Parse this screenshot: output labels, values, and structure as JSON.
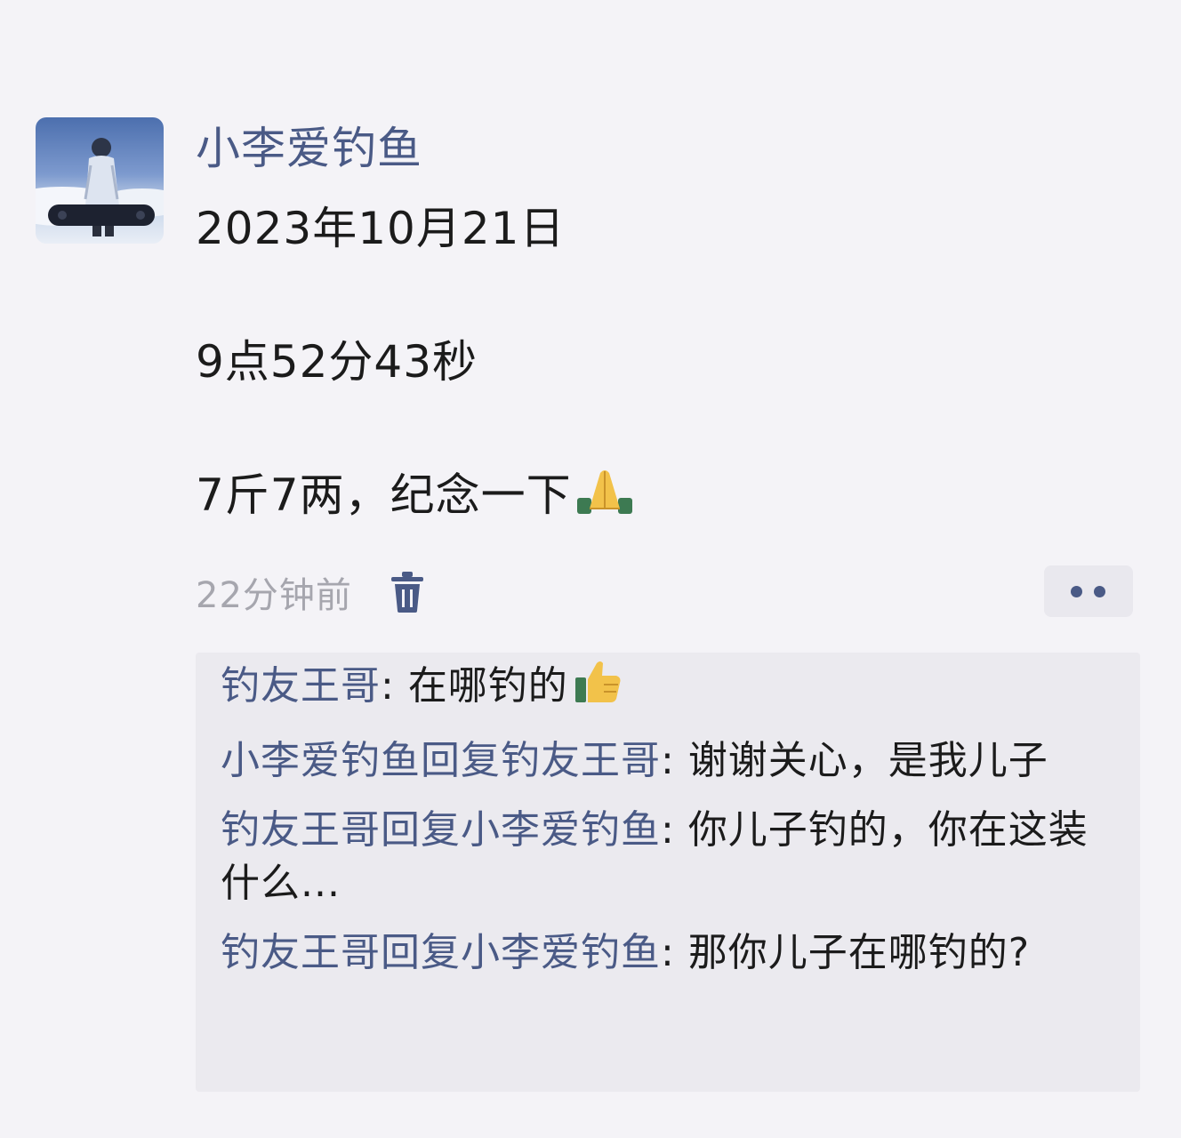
{
  "post": {
    "author": "小李爱钓鱼",
    "lines": [
      "2023年10月21日",
      "9点52分43秒",
      "7斤7两，纪念一下"
    ],
    "emoji_icon": "praying-hands-icon",
    "timestamp": "22分钟前",
    "delete_icon": "trash-icon",
    "more_icon": "more-dots-icon"
  },
  "comments": [
    {
      "from": "钓友王哥",
      "reply_word": "",
      "to": "",
      "sep": ": ",
      "text": "在哪钓的",
      "emoji_icon": "thumbs-up-icon"
    },
    {
      "from": "小李爱钓鱼",
      "reply_word": "回复",
      "to": "钓友王哥",
      "sep": ": ",
      "text": "谢谢关心，是我儿子"
    },
    {
      "from": "钓友王哥",
      "reply_word": "回复",
      "to": "小李爱钓鱼",
      "sep": ": ",
      "text": "你儿子钓的，你在这装什么..."
    },
    {
      "from": "钓友王哥",
      "reply_word": "回复",
      "to": "小李爱钓鱼",
      "sep": ": ",
      "text": "那你儿子在哪钓的?"
    }
  ],
  "colors": {
    "background": "#f4f3f7",
    "name_link": "#4a5a86",
    "text": "#1b1b1b",
    "timestamp": "#a6a6ae",
    "comment_bg": "#ebeaef"
  }
}
